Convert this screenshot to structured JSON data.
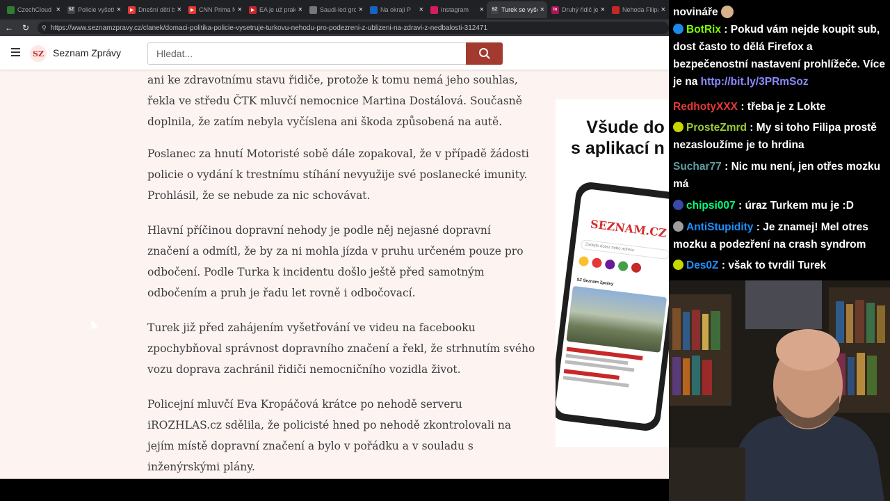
{
  "tabs": [
    {
      "title": "CzechCloud",
      "color": "#2e7d32",
      "glyph": ""
    },
    {
      "title": "Policie vyšetř",
      "color": "#444",
      "glyph": "SZ"
    },
    {
      "title": "Dnešní děti b",
      "color": "#e53935",
      "glyph": "▶"
    },
    {
      "title": "CNN Prima N",
      "color": "#e53935",
      "glyph": "▶"
    },
    {
      "title": "EA je už prak",
      "color": "#c62828",
      "glyph": "▶"
    },
    {
      "title": "Saudi-led gro",
      "color": "#777",
      "glyph": ""
    },
    {
      "title": "Na okraji P",
      "color": "#1565c0",
      "glyph": ""
    },
    {
      "title": "Instagram",
      "color": "#d81b60",
      "glyph": ""
    },
    {
      "title": "Turek se vyše",
      "color": "#444",
      "glyph": "SZ"
    },
    {
      "title": "Druhý řidič je",
      "color": "#ad1457",
      "glyph": "in"
    },
    {
      "title": "Nehoda Filipa",
      "color": "#c62828",
      "glyph": ""
    }
  ],
  "url": "https://www.seznamzpravy.cz/clanek/domaci-politika-policie-vysetruje-turkovu-nehodu-pro-podezreni-z-ublizeni-na-zdravi-z-nedbalosti-312471",
  "site": {
    "logo": "SZ",
    "brand": "Seznam Zprávy",
    "search_placeholder": "Hledat..."
  },
  "article": {
    "paragraphs": [
      "ani ke zdravotnímu stavu řidiče, protože k tomu nemá jeho souhlas, řekla ve středu ČTK mluvčí nemocnice Martina Dostálová. Současně doplnila, že zatím nebyla vyčíslena ani škoda způsobená na autě.",
      "Poslanec za hnutí Motoristé sobě dále zopakoval, že v případě žádosti policie o vydání k trestnímu stíhání nevyužije své poslanecké imunity. Prohlásil, že se nebude za nic schovávat.",
      "Hlavní příčinou dopravní nehody je podle něj nejasné dopravní značení a odmítl, že by za ni mohla jízda v pruhu určeném pouze pro odbočení. Podle Turka k incidentu došlo ještě před samotným odbočením a pruh je řadu let rovně i odbočovací.",
      "Turek již před zahájením vyšetřování ve videu na facebooku zpochybňoval správnost dopravního značení a řekl, že strhnutím svého vozu doprava zachránil řidiči nemocničního vozidla život.",
      "Policejní mluvčí Eva Kropáčová krátce po nehodě serveru iROZHLAS.cz sdělila, že policisté hned po nehodě zkontrolovali na jejím místě dopravní značení a bylo v pořádku a v souladu s inženýrskými plány."
    ]
  },
  "ad": {
    "line1": "Všude do",
    "line2": "s aplikací n",
    "phone_brand": "SEZNAM.CZ",
    "phone_search": "Zadejte dotaz nebo adresu",
    "phone_news": "SZ Seznam Zprávy"
  },
  "chat": {
    "top": "novináře",
    "messages": [
      {
        "user": "BotRix",
        "color": "#7fff00",
        "badge": "#1e88e5",
        "text": "Pokud vám nejde koupit sub, dost často to dělá Firefox a bezpečenostní nastavení prohlížeče. Více je na",
        "link": "http://bit.ly/3PRmSoz"
      },
      {
        "user": "RedhotyXXX",
        "color": "#e53935",
        "badge": "",
        "text": "třeba je z Lokte",
        "link": ""
      },
      {
        "user": "ProsteZmrd",
        "color": "#9acd32",
        "badge": "#c6d800",
        "text": "My si toho Filipa prostě nezasloužíme je to hrdina",
        "link": ""
      },
      {
        "user": "Suchar77",
        "color": "#5f9ea0",
        "badge": "",
        "text": "Nic mu není, jen otřes mozku má",
        "link": ""
      },
      {
        "user": "chipsi007",
        "color": "#00ff7f",
        "badge": "#3949ab",
        "text": "úraz Turkem mu je :D",
        "link": ""
      },
      {
        "user": "AntiStupidity",
        "color": "#1e90ff",
        "badge": "#9e9e9e",
        "text": "Je znamej! Mel otres mozku a podezření na crash syndrom",
        "link": ""
      },
      {
        "user": "Des0Z",
        "color": "#1e90ff",
        "badge": "#c6d800",
        "text": "však to tvrdil Turek",
        "link": ""
      }
    ]
  },
  "colors": {
    "accent": "#a33a2f",
    "article_bg": "#fdf4f2",
    "link": "#8a8aff"
  }
}
